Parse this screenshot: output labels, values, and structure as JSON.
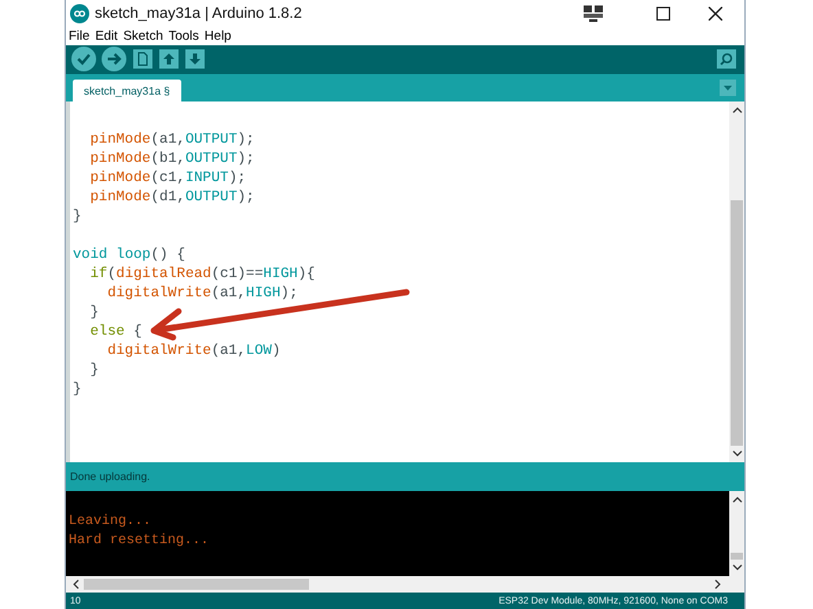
{
  "window": {
    "title": "sketch_may31a | Arduino 1.8.2"
  },
  "menu": [
    "File",
    "Edit",
    "Sketch",
    "Tools",
    "Help"
  ],
  "tabs": [
    {
      "label": "sketch_may31a §",
      "selected": true
    }
  ],
  "editor": {
    "lines": [
      {
        "kind": "blank"
      },
      {
        "kind": "code",
        "tokens": [
          {
            "t": "  pinMode",
            "kind": "func"
          },
          {
            "t": "(a1,",
            "kind": "plain"
          },
          {
            "t": "OUTPUT",
            "kind": "const"
          },
          {
            "t": ");",
            "kind": "plain"
          }
        ]
      },
      {
        "kind": "code",
        "tokens": [
          {
            "t": "  pinMode",
            "kind": "func"
          },
          {
            "t": "(b1,",
            "kind": "plain"
          },
          {
            "t": "OUTPUT",
            "kind": "const"
          },
          {
            "t": ");",
            "kind": "plain"
          }
        ]
      },
      {
        "kind": "code",
        "tokens": [
          {
            "t": "  pinMode",
            "kind": "func"
          },
          {
            "t": "(c1,",
            "kind": "plain"
          },
          {
            "t": "INPUT",
            "kind": "const"
          },
          {
            "t": ");",
            "kind": "plain"
          }
        ]
      },
      {
        "kind": "code",
        "tokens": [
          {
            "t": "  pinMode",
            "kind": "func"
          },
          {
            "t": "(d1,",
            "kind": "plain"
          },
          {
            "t": "OUTPUT",
            "kind": "const"
          },
          {
            "t": ");",
            "kind": "plain"
          }
        ]
      },
      {
        "kind": "code",
        "tokens": [
          {
            "t": "}",
            "kind": "plain"
          }
        ]
      },
      {
        "kind": "blank"
      },
      {
        "kind": "code",
        "tokens": [
          {
            "t": "void",
            "kind": "type"
          },
          {
            "t": " loop",
            "kind": "type"
          },
          {
            "t": "() {",
            "kind": "plain"
          }
        ]
      },
      {
        "kind": "code",
        "tokens": [
          {
            "t": "  if",
            "kind": "keyword"
          },
          {
            "t": "(",
            "kind": "plain"
          },
          {
            "t": "digitalRead",
            "kind": "func"
          },
          {
            "t": "(c1)==",
            "kind": "plain"
          },
          {
            "t": "HIGH",
            "kind": "const"
          },
          {
            "t": "){",
            "kind": "plain"
          }
        ]
      },
      {
        "kind": "code",
        "tokens": [
          {
            "t": "    digitalWrite",
            "kind": "func"
          },
          {
            "t": "(a1,",
            "kind": "plain"
          },
          {
            "t": "HIGH",
            "kind": "const"
          },
          {
            "t": ");",
            "kind": "plain"
          }
        ]
      },
      {
        "kind": "code",
        "tokens": [
          {
            "t": "  }",
            "kind": "plain"
          }
        ]
      },
      {
        "kind": "code",
        "tokens": [
          {
            "t": "  else",
            "kind": "keyword"
          },
          {
            "t": " {",
            "kind": "plain"
          }
        ]
      },
      {
        "kind": "code",
        "tokens": [
          {
            "t": "    digitalWrite",
            "kind": "func"
          },
          {
            "t": "(a1,",
            "kind": "plain"
          },
          {
            "t": "LOW",
            "kind": "const"
          },
          {
            "t": ")",
            "kind": "plain"
          }
        ]
      },
      {
        "kind": "code",
        "tokens": [
          {
            "t": "  }",
            "kind": "plain"
          }
        ]
      },
      {
        "kind": "code",
        "tokens": [
          {
            "t": "}",
            "kind": "plain"
          }
        ]
      }
    ]
  },
  "message_bar": "Done uploading.",
  "console": {
    "lines": [
      "Leaving...",
      "Hard resetting..."
    ]
  },
  "status_bar": {
    "line": "10",
    "board": "ESP32 Dev Module, 80MHz, 921600, None on COM3"
  }
}
